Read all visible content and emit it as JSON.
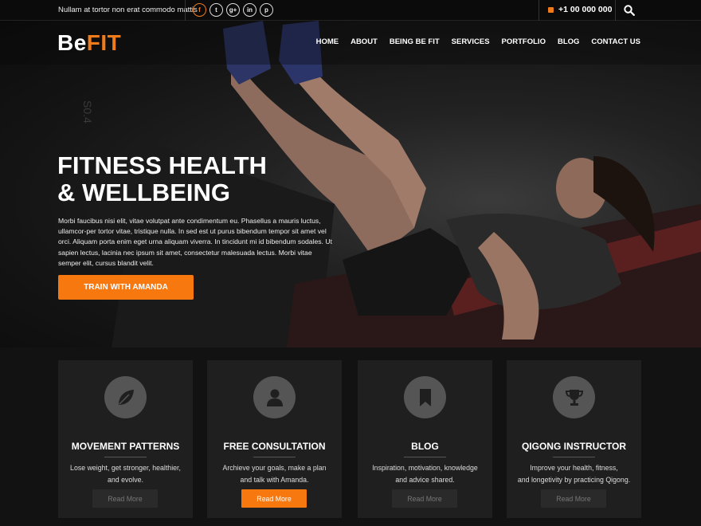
{
  "topbar": {
    "tagline": "Nullam at tortor non erat commodo mattis",
    "socials": [
      "f",
      "t",
      "g+",
      "in",
      "p"
    ],
    "phone": "+1 00 000 000"
  },
  "header": {
    "logo_be": "Be",
    "logo_fit": "FIT",
    "nav": [
      "HOME",
      "ABOUT",
      "BEING BE FIT",
      "SERVICES",
      "PORTFOLIO",
      "BLOG",
      "CONTACT US"
    ]
  },
  "hero": {
    "title_line1": "FITNESS HEALTH",
    "title_line2": "& WELLBEING",
    "text": "Morbi faucibus nisi elit, vitae volutpat ante condimentum eu. Phasellus a mauris luctus, ullamcor-per tortor vitae, tristique nulla. In sed est ut purus bibendum tempor sit amet vel orci. Aliquam porta enim eget urna aliquam viverra. In tincidunt mi id bibendum sodales. Ut sapien lectus, lacinia nec ipsum sit amet, consectetur malesuada lectus. Morbi vitae semper elit, cursus blandit velit.",
    "button": "TRAIN WITH AMANDA"
  },
  "services": [
    {
      "icon": "leaf-icon",
      "title": "MOVEMENT PATTERNS",
      "line1": "Lose weight, get stronger, healthier,",
      "line2": "and evolve.",
      "button": "Read More"
    },
    {
      "icon": "user-icon",
      "title": "FREE CONSULTATION",
      "line1": "Archieve your goals, make a plan",
      "line2": "and talk with Amanda.",
      "button": "Read More"
    },
    {
      "icon": "bookmark-icon",
      "title": "BLOG",
      "line1": "Inspiration, motivation, knowledge",
      "line2": "and advice shared.",
      "button": "Read More"
    },
    {
      "icon": "trophy-icon",
      "title": "QIGONG INSTRUCTOR",
      "line1": "Improve your health, fitness,",
      "line2": "and longetivity by practicing Qigong.",
      "button": "Read More"
    }
  ],
  "colors": {
    "accent": "#f7780f",
    "background": "#121212",
    "card": "#1f1f1f"
  }
}
